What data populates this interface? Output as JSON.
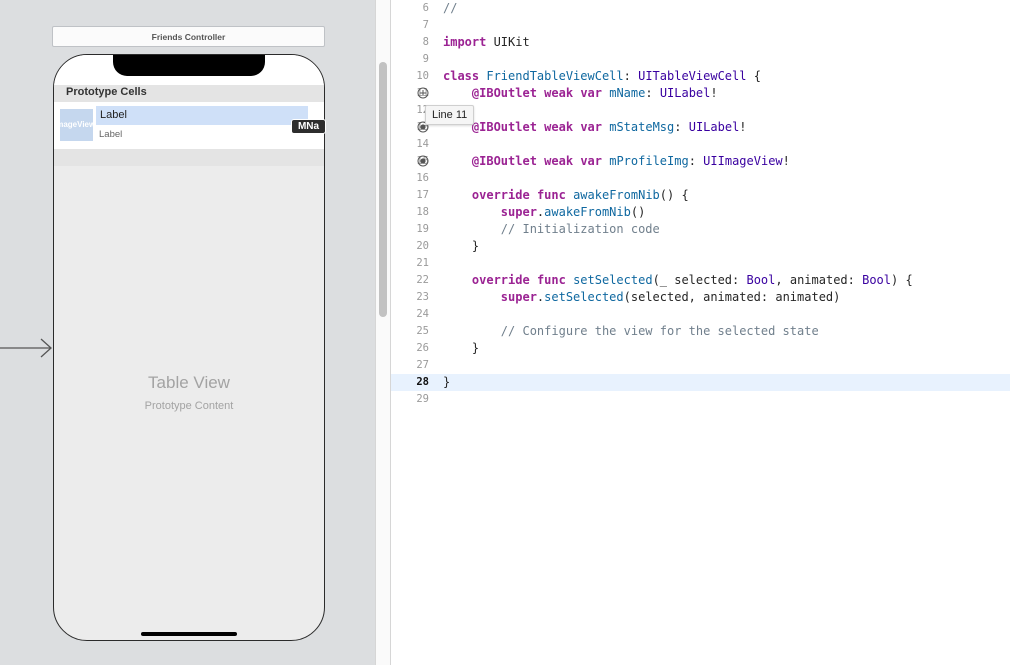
{
  "storyboard": {
    "scene_title": "Friends Controller",
    "prototype_header": "Prototype Cells",
    "cell": {
      "image_placeholder": "imageView",
      "name_label": "Label",
      "state_label": "Label"
    },
    "table_view_title": "Table View",
    "table_view_subtitle": "Prototype Content",
    "outlet_badge": "MNa"
  },
  "editor": {
    "tooltip": "Line 11",
    "current_line": 28,
    "colors": {
      "keyword": "#9b2393",
      "type": "#3900a0",
      "declaration": "#0f68a0",
      "comment": "#707f8c",
      "current_line_bg": "#e8f2fe"
    },
    "lines": [
      {
        "n": "6",
        "text": "//"
      },
      {
        "n": "7",
        "text": ""
      },
      {
        "n": "8",
        "text": "import UIKit"
      },
      {
        "n": "9",
        "text": ""
      },
      {
        "n": "10",
        "text": "class FriendTableViewCell: UITableViewCell {"
      },
      {
        "n": "11",
        "text": "    @IBOutlet weak var mName: UILabel!"
      },
      {
        "n": "12",
        "text": ""
      },
      {
        "n": "13",
        "text": "    @IBOutlet weak var mStateMsg: UILabel!"
      },
      {
        "n": "14",
        "text": ""
      },
      {
        "n": "15",
        "text": "    @IBOutlet weak var mProfileImg: UIImageView!"
      },
      {
        "n": "16",
        "text": ""
      },
      {
        "n": "17",
        "text": "    override func awakeFromNib() {"
      },
      {
        "n": "18",
        "text": "        super.awakeFromNib()"
      },
      {
        "n": "19",
        "text": "        // Initialization code"
      },
      {
        "n": "20",
        "text": "    }"
      },
      {
        "n": "21",
        "text": ""
      },
      {
        "n": "22",
        "text": "    override func setSelected(_ selected: Bool, animated: Bool) {"
      },
      {
        "n": "23",
        "text": "        super.setSelected(selected, animated: animated)"
      },
      {
        "n": "24",
        "text": ""
      },
      {
        "n": "25",
        "text": "        // Configure the view for the selected state"
      },
      {
        "n": "26",
        "text": "    }"
      },
      {
        "n": "27",
        "text": ""
      },
      {
        "n": "28",
        "text": "}"
      },
      {
        "n": "29",
        "text": ""
      }
    ]
  }
}
